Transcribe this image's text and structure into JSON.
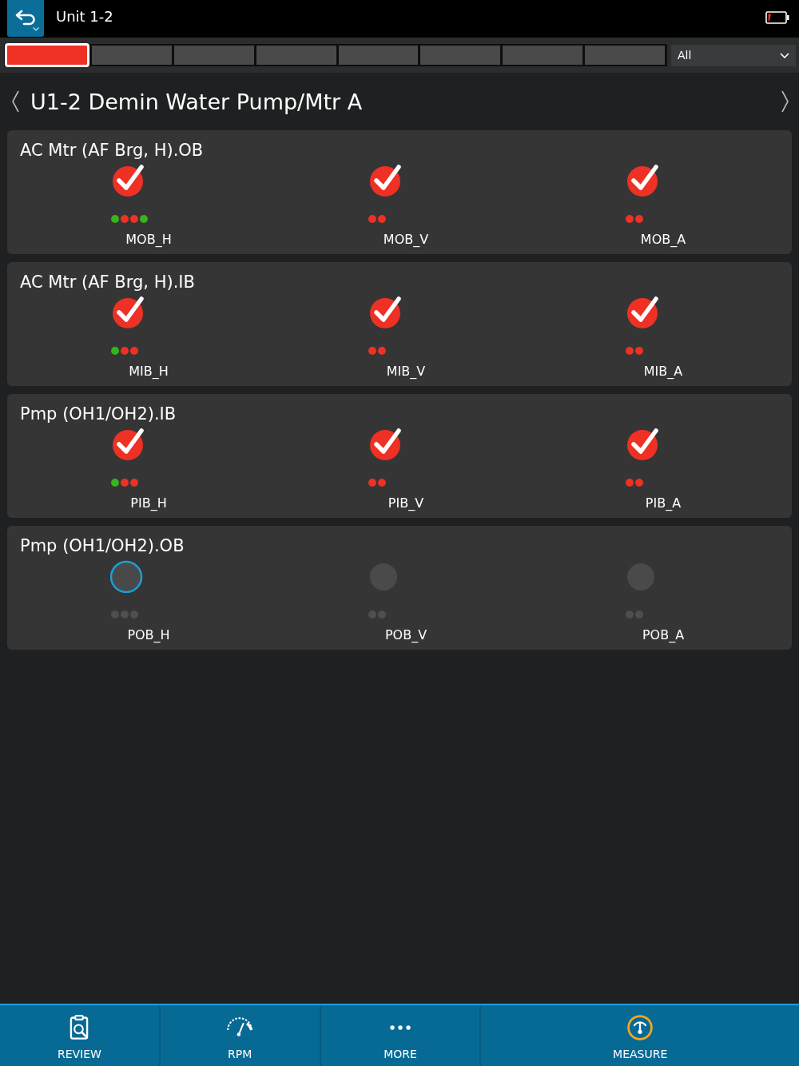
{
  "header": {
    "title": "Unit 1-2"
  },
  "route_progress": {
    "segments": [
      {
        "color": "#ee3124",
        "selected": true
      },
      {
        "color": "#4a4a4a",
        "selected": false
      },
      {
        "color": "#4a4a4a",
        "selected": false
      },
      {
        "color": "#4a4a4a",
        "selected": false
      },
      {
        "color": "#4a4a4a",
        "selected": false
      },
      {
        "color": "#4a4a4a",
        "selected": false
      },
      {
        "color": "#4a4a4a",
        "selected": false
      },
      {
        "color": "#4a4a4a",
        "selected": false
      }
    ]
  },
  "filter": {
    "value": "All"
  },
  "asset": {
    "title": "U1-2 Demin Water Pump/Mtr A"
  },
  "locations": [
    {
      "title": "AC Mtr (AF Brg, H).OB",
      "points": [
        {
          "label": "MOB_H",
          "kind": "done",
          "selected": false,
          "dots": [
            {
              "color": "#39b31a"
            },
            {
              "color": "#ee3124"
            },
            {
              "color": "#ee3124"
            },
            {
              "color": "#39b31a"
            }
          ]
        },
        {
          "label": "MOB_V",
          "kind": "done",
          "selected": false,
          "dots": [
            {
              "color": "#ee3124"
            },
            {
              "color": "#ee3124"
            }
          ]
        },
        {
          "label": "MOB_A",
          "kind": "done",
          "selected": false,
          "dots": [
            {
              "color": "#ee3124"
            },
            {
              "color": "#ee3124"
            }
          ]
        }
      ]
    },
    {
      "title": "AC Mtr (AF Brg, H).IB",
      "points": [
        {
          "label": "MIB_H",
          "kind": "done",
          "selected": false,
          "dots": [
            {
              "color": "#39b31a"
            },
            {
              "color": "#ee3124"
            },
            {
              "color": "#ee3124"
            }
          ]
        },
        {
          "label": "MIB_V",
          "kind": "done",
          "selected": false,
          "dots": [
            {
              "color": "#ee3124"
            },
            {
              "color": "#ee3124"
            }
          ]
        },
        {
          "label": "MIB_A",
          "kind": "done",
          "selected": false,
          "dots": [
            {
              "color": "#ee3124"
            },
            {
              "color": "#ee3124"
            }
          ]
        }
      ]
    },
    {
      "title": "Pmp (OH1/OH2).IB",
      "points": [
        {
          "label": "PIB_H",
          "kind": "done",
          "selected": false,
          "dots": [
            {
              "color": "#39b31a"
            },
            {
              "color": "#ee3124"
            },
            {
              "color": "#ee3124"
            }
          ]
        },
        {
          "label": "PIB_V",
          "kind": "done",
          "selected": false,
          "dots": [
            {
              "color": "#ee3124"
            },
            {
              "color": "#ee3124"
            }
          ]
        },
        {
          "label": "PIB_A",
          "kind": "done",
          "selected": false,
          "dots": [
            {
              "color": "#ee3124"
            },
            {
              "color": "#ee3124"
            }
          ]
        }
      ]
    },
    {
      "title": "Pmp (OH1/OH2).OB",
      "points": [
        {
          "label": "POB_H",
          "kind": "pending",
          "selected": true,
          "dots": [
            {
              "color": "#4f4f4f"
            },
            {
              "color": "#4f4f4f"
            },
            {
              "color": "#4f4f4f"
            }
          ]
        },
        {
          "label": "POB_V",
          "kind": "pending",
          "selected": false,
          "dots": [
            {
              "color": "#4f4f4f"
            },
            {
              "color": "#4f4f4f"
            }
          ]
        },
        {
          "label": "POB_A",
          "kind": "pending",
          "selected": false,
          "dots": [
            {
              "color": "#4f4f4f"
            },
            {
              "color": "#4f4f4f"
            }
          ]
        }
      ]
    }
  ],
  "bottom_nav": [
    {
      "label": "REVIEW",
      "kind": "review"
    },
    {
      "label": "RPM",
      "kind": "rpm"
    },
    {
      "label": "MORE",
      "kind": "more"
    },
    {
      "label": "MEASURE",
      "kind": "measure"
    }
  ]
}
